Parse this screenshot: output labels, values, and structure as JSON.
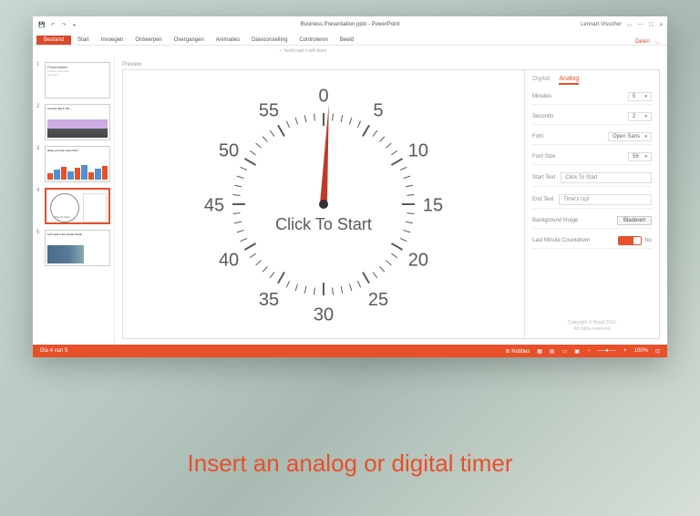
{
  "window": {
    "title": "Business Presentation.pptx - PowerPoint",
    "account": "Lennart Visscher",
    "search_hint": "Vertel wat u wilt doen"
  },
  "ribbon": {
    "file": "Bestand",
    "tabs": [
      "Start",
      "Invoegen",
      "Ontwerpen",
      "Overgangen",
      "Animaties",
      "Diavoorstelling",
      "Controleren",
      "Beeld"
    ],
    "share": "Delen"
  },
  "thumbnails": {
    "slides": [
      {
        "num": "1",
        "title": "Presentation"
      },
      {
        "num": "2",
        "title": "A lovely day in the..."
      },
      {
        "num": "3",
        "title": "Have you ever seen this?"
      },
      {
        "num": "4",
        "title": "Click To Start"
      },
      {
        "num": "5",
        "title": "Let's wait a 10-minute break..."
      }
    ],
    "active_index": 3
  },
  "preview_label": "Preview",
  "clock": {
    "numbers": [
      "0",
      "5",
      "10",
      "15",
      "20",
      "25",
      "30",
      "35",
      "40",
      "45",
      "50",
      "55"
    ],
    "center_text": "Click To Start"
  },
  "panel": {
    "tab_digital": "Digital",
    "tab_analog": "Analog",
    "minutes_label": "Minutes",
    "minutes_value": "5",
    "seconds_label": "Seconds",
    "seconds_value": "2",
    "font_label": "Font",
    "font_value": "Open Sans",
    "fontsize_label": "Font Size",
    "fontsize_value": "56",
    "start_text_label": "Start Text",
    "start_text_value": "Click To Start",
    "end_text_label": "End Text",
    "end_text_value": "Time's Up!",
    "bg_label": "Background Image",
    "bg_browse": "Bladeren",
    "lmc_label": "Last Minute Countdown",
    "lmc_value": "No",
    "copyright_line1": "Copyright © Bygitt 2016",
    "copyright_line2": "All rights reserved"
  },
  "status": {
    "left": "Dia 4 van 5",
    "notes": "Notities",
    "zoom": "100%"
  },
  "caption": "Insert an analog or digital timer"
}
